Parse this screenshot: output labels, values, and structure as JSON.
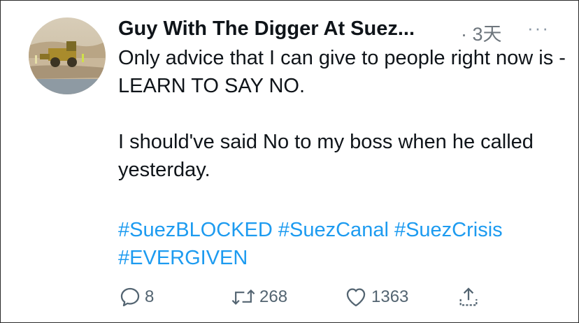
{
  "tweet": {
    "author_name": "Guy With The Digger At Suez...",
    "time": "· 3天",
    "more": "···",
    "paragraph1": "Only advice that I can give to people right now is - LEARN TO SAY NO.",
    "paragraph2": "I should've said No to my boss when he called yesterday.",
    "hashtags": [
      "#SuezBLOCKED",
      "#SuezCanal",
      "#SuezCrisis",
      "#EVERGIVEN"
    ]
  },
  "actions": {
    "reply": {
      "icon": "reply-icon",
      "count": "8"
    },
    "retweet": {
      "icon": "retweet-icon",
      "count": "268"
    },
    "like": {
      "icon": "heart-icon",
      "count": "1363"
    },
    "share": {
      "icon": "share-icon"
    }
  },
  "colors": {
    "text": "#0f1419",
    "muted": "#6e767d",
    "link": "#1d9bf0",
    "action": "#536471"
  }
}
